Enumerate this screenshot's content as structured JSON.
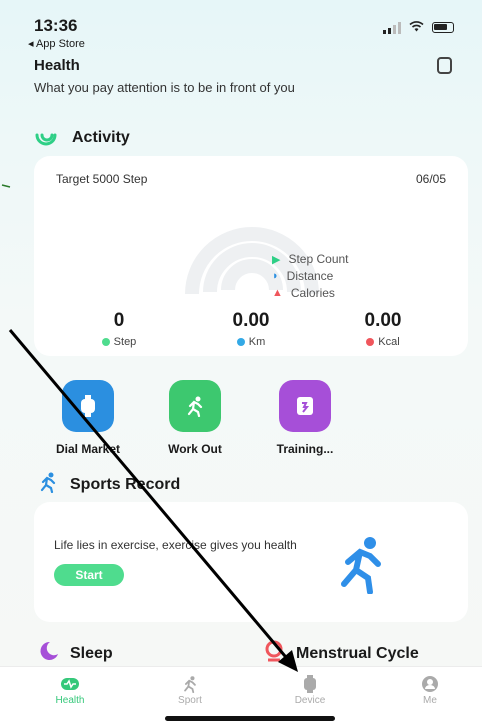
{
  "status": {
    "time": "13:36",
    "back_label": "◂ App Store"
  },
  "header": {
    "title": "Health",
    "subtitle": "What you pay attention is to be in front of you"
  },
  "activity": {
    "title": "Activity",
    "target": "Target  5000 Step",
    "date": "06/05",
    "legend": [
      "Step Count",
      "Distance",
      "Calories"
    ],
    "stats": [
      {
        "value": "0",
        "unit": "Step",
        "color": "#4fdc8e"
      },
      {
        "value": "0.00",
        "unit": "Km",
        "color": "#33a9e6"
      },
      {
        "value": "0.00",
        "unit": "Kcal",
        "color": "#f0565c"
      }
    ]
  },
  "shortcuts": [
    {
      "label": "Dial Market",
      "color": "#2b8fe0",
      "icon": "watch-icon"
    },
    {
      "label": "Work Out",
      "color": "#3dc86f",
      "icon": "runner-icon"
    },
    {
      "label": "Training...",
      "color": "#a64fd8",
      "icon": "training-icon"
    }
  ],
  "sports_record": {
    "title": "Sports Record",
    "motto": "Life lies in exercise, exercise gives you health",
    "start_label": "Start"
  },
  "sleep": {
    "title": "Sleep"
  },
  "menstrual": {
    "title": "Menstrual Cycle"
  },
  "tabs": [
    {
      "label": "Health",
      "icon": "heart-icon",
      "active": true
    },
    {
      "label": "Sport",
      "icon": "runner-icon",
      "active": false
    },
    {
      "label": "Device",
      "icon": "watch-icon",
      "active": false
    },
    {
      "label": "Me",
      "icon": "person-icon",
      "active": false
    }
  ]
}
